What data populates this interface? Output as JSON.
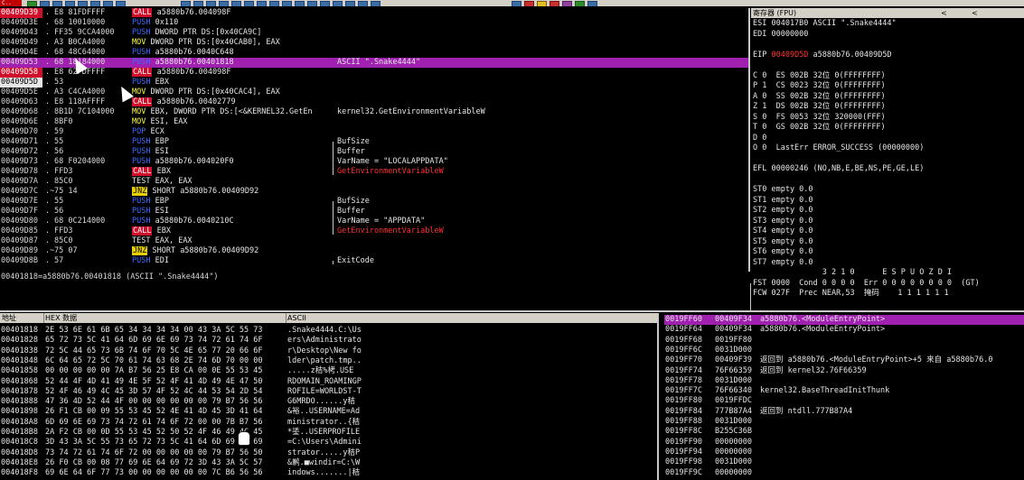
{
  "toolbar": {
    "title": "C.."
  },
  "disasm": {
    "rows": [
      {
        "addr": "00409D39",
        "mark": ".",
        "hex": "E8 81FDFFFF",
        "mn_kw": "CALL",
        "mn_kw_type": "call",
        "mn_rest": "a5880b76.004098F",
        "comment": "",
        "addr_style": "red",
        "selected": false
      },
      {
        "addr": "00409D3E",
        "mark": ".",
        "hex": "68 10010000",
        "mn_kw": "PUSH",
        "mn_kw_type": "push",
        "mn_rest": "0x110",
        "comment": "",
        "addr_style": "",
        "selected": false
      },
      {
        "addr": "00409D43",
        "mark": ".",
        "hex": "FF35 9CCA4000",
        "mn_kw": "PUSH",
        "mn_kw_type": "push",
        "mn_rest": "DWORD PTR DS:[0x40CA9C]",
        "comment": "",
        "addr_style": "",
        "selected": false
      },
      {
        "addr": "00409D49",
        "mark": ".",
        "hex": "A3 B0CA4000",
        "mn_kw": "MOV",
        "mn_kw_type": "mov",
        "mn_rest": "DWORD PTR DS:[0x40CAB0], EAX",
        "comment": "",
        "addr_style": "",
        "selected": false
      },
      {
        "addr": "00409D4E",
        "mark": ".",
        "hex": "68 48C64000",
        "mn_kw": "PUSH",
        "mn_kw_type": "push",
        "mn_rest": "a5880b76.0040C648",
        "comment": "",
        "addr_style": "",
        "selected": false
      },
      {
        "addr": "00409D53",
        "mark": ".",
        "hex": "68 18184000",
        "mn_kw": "PUSH",
        "mn_kw_type": "push",
        "mn_rest": "a5880b76.00401818",
        "comment": "ASCII \".Snake4444\"",
        "addr_style": "",
        "selected": true
      },
      {
        "addr": "00409D58",
        "mark": ".",
        "hex": "E8 62FDFFFF",
        "mn_kw": "CALL",
        "mn_kw_type": "call",
        "mn_rest": "a5880b76.004098F",
        "comment": "",
        "addr_style": "red",
        "selected": false
      },
      {
        "addr": "00409D5D",
        "mark": ".",
        "hex": "53",
        "mn_kw": "PUSH",
        "mn_kw_type": "push",
        "mn_rest": "EBX",
        "comment": "",
        "addr_style": "inv",
        "selected": false
      },
      {
        "addr": "00409D5E",
        "mark": ".",
        "hex": "A3 C4CA4000",
        "mn_kw": "MOV",
        "mn_kw_type": "mov",
        "mn_rest": "DWORD PTR DS:[0x40CAC4], EAX",
        "comment": "",
        "addr_style": "",
        "selected": false
      },
      {
        "addr": "00409D63",
        "mark": ".",
        "hex": "E8 118AFFFF",
        "mn_kw": "CALL",
        "mn_kw_type": "call",
        "mn_rest": "a5880b76.00402779",
        "comment": "",
        "addr_style": "",
        "selected": false
      },
      {
        "addr": "00409D68",
        "mark": ".",
        "hex": "8B1D 7C104000",
        "mn_kw": "MOV",
        "mn_kw_type": "mov",
        "mn_rest": "EBX, DWORD PTR DS:[<&KERNEL32.GetEn",
        "comment": "kernel32.GetEnvironmentVariableW",
        "addr_style": "",
        "selected": false
      },
      {
        "addr": "00409D6E",
        "mark": ".",
        "hex": "8BF0",
        "mn_kw": "MOV",
        "mn_kw_type": "mov2",
        "mn_rest": "ESI, EAX",
        "comment": "",
        "addr_style": "",
        "selected": false
      },
      {
        "addr": "00409D70",
        "mark": ".",
        "hex": "59",
        "mn_kw": "POP",
        "mn_kw_type": "pop",
        "mn_rest": "ECX",
        "comment": "",
        "addr_style": "",
        "selected": false
      },
      {
        "addr": "00409D71",
        "mark": ".",
        "hex": "55",
        "mn_kw": "PUSH",
        "mn_kw_type": "push",
        "mn_rest": "EBP",
        "comment": "BufSize",
        "addr_style": "",
        "selected": false
      },
      {
        "addr": "00409D72",
        "mark": ".",
        "hex": "56",
        "mn_kw": "PUSH",
        "mn_kw_type": "push",
        "mn_rest": "ESI",
        "comment": "Buffer",
        "addr_style": "",
        "selected": false
      },
      {
        "addr": "00409D73",
        "mark": ".",
        "hex": "68 F0204000",
        "mn_kw": "PUSH",
        "mn_kw_type": "push",
        "mn_rest": "a5880b76.004020F0",
        "comment": "VarName = \"LOCALAPPDATA\"",
        "addr_style": "",
        "selected": false
      },
      {
        "addr": "00409D78",
        "mark": ".",
        "hex": "FFD3",
        "mn_kw": "CALL",
        "mn_kw_type": "call",
        "mn_rest": "EBX",
        "comment": "GetEnvironmentVariableW",
        "comment_red": true,
        "addr_style": "",
        "selected": false
      },
      {
        "addr": "00409D7A",
        "mark": ".",
        "hex": "85C0",
        "mn_kw": "TEST",
        "mn_kw_type": "test",
        "mn_rest": "EAX, EAX",
        "comment": "",
        "addr_style": "",
        "selected": false
      },
      {
        "addr": "00409D7C",
        "mark": ".~",
        "hex": "75 14",
        "mn_kw": "JNZ",
        "mn_kw_type": "jmp",
        "mn_rest": "SHORT a5880b76.00409D92",
        "comment": "",
        "addr_style": "",
        "selected": false
      },
      {
        "addr": "00409D7E",
        "mark": ".",
        "hex": "55",
        "mn_kw": "PUSH",
        "mn_kw_type": "push",
        "mn_rest": "EBP",
        "comment": "BufSize",
        "addr_style": "",
        "selected": false
      },
      {
        "addr": "00409D7F",
        "mark": ".",
        "hex": "56",
        "mn_kw": "PUSH",
        "mn_kw_type": "push",
        "mn_rest": "ESI",
        "comment": "Buffer",
        "addr_style": "",
        "selected": false
      },
      {
        "addr": "00409D80",
        "mark": ".",
        "hex": "68 0C214000",
        "mn_kw": "PUSH",
        "mn_kw_type": "push",
        "mn_rest": "a5880b76.0040210C",
        "comment": "VarName = \"APPDATA\"",
        "addr_style": "",
        "selected": false
      },
      {
        "addr": "00409D85",
        "mark": ".",
        "hex": "FFD3",
        "mn_kw": "CALL",
        "mn_kw_type": "call",
        "mn_rest": "EBX",
        "comment": "GetEnvironmentVariableW",
        "comment_red": true,
        "addr_style": "",
        "selected": false
      },
      {
        "addr": "00409D87",
        "mark": ".",
        "hex": "85C0",
        "mn_kw": "TEST",
        "mn_kw_type": "test",
        "mn_rest": "EAX, EAX",
        "comment": "",
        "addr_style": "",
        "selected": false
      },
      {
        "addr": "00409D89",
        "mark": ".~",
        "hex": "75 07",
        "mn_kw": "JNZ",
        "mn_kw_type": "jmp",
        "mn_rest": "SHORT a5880b76.00409D92",
        "comment": "",
        "addr_style": "",
        "selected": false
      },
      {
        "addr": "00409D8B",
        "mark": ".",
        "hex": "57",
        "mn_kw": "PUSH",
        "mn_kw_type": "push",
        "mn_rest": "EDI",
        "comment": "ExitCode",
        "addr_style": "",
        "selected": false
      }
    ],
    "status": "00401818=a5880b76.00401818 (ASCII \".Snake4444\")"
  },
  "registers": {
    "title": "寄存器 (FPU)",
    "nav_left": "<",
    "nav_right": "<",
    "lines": [
      {
        "text": "ESI 004017B0 ASCII \".Snake4444\""
      },
      {
        "text": "EDI 00000000"
      },
      {
        "text": ""
      },
      {
        "text": "EIP ",
        "red": "00409D5D",
        "after": " a5880b76.00409D5D"
      },
      {
        "text": ""
      },
      {
        "text": "C 0  ES 002B 32位 0(FFFFFFFF)"
      },
      {
        "text": "P 1  CS 0023 32位 0(FFFFFFFF)"
      },
      {
        "text": "A 0  SS 002B 32位 0(FFFFFFFF)"
      },
      {
        "text": "Z 1  DS 002B 32位 0(FFFFFFFF)"
      },
      {
        "text": "S 0  FS 0053 32位 320000(FFF)"
      },
      {
        "text": "T 0  GS 002B 32位 0(FFFFFFFF)"
      },
      {
        "text": "D 0"
      },
      {
        "text": "O 0  LastErr ERROR_SUCCESS (00000000)"
      },
      {
        "text": ""
      },
      {
        "text": "EFL 00000246 (NO,NB,E,BE,NS,PE,GE,LE)"
      },
      {
        "text": ""
      },
      {
        "text": "ST0 empty 0.0"
      },
      {
        "text": "ST1 empty 0.0"
      },
      {
        "text": "ST2 empty 0.0"
      },
      {
        "text": "ST3 empty 0.0"
      },
      {
        "text": "ST4 empty 0.0"
      },
      {
        "text": "ST5 empty 0.0"
      },
      {
        "text": "ST6 empty 0.0"
      },
      {
        "text": "ST7 empty 0.0"
      },
      {
        "text": "               3 2 1 0      E S P U O Z D I"
      },
      {
        "text": "FST 0000  Cond 0 0 0 0  Err 0 0 0 0 0 0 0 0  (GT)"
      },
      {
        "text": "FCW 027F  Prec NEAR,53  掩码    1 1 1 1 1 1"
      }
    ]
  },
  "dump": {
    "col_addr": "地址",
    "col_hex": "HEX 数据",
    "col_ascii": "ASCII",
    "rows": [
      {
        "addr": "00401818",
        "hex": "2E 53 6E 61 6B 65 34 34 34 34 00 43 3A 5C 55 73",
        "ascii": ".Snake4444.C:\\Us"
      },
      {
        "addr": "00401828",
        "hex": "65 72 73 5C 41 64 6D 69 6E 69 73 74 72 61 74 6F",
        "ascii": "ers\\Administrato"
      },
      {
        "addr": "00401838",
        "hex": "72 5C 44 65 73 6B 74 6F 70 5C 4E 65 77 20 66 6F",
        "ascii": "r\\Desktop\\New fo"
      },
      {
        "addr": "00401848",
        "hex": "6C 64 65 72 5C 70 61 74 63 68 2E 74 6D 70 00 00",
        "ascii": "lder\\patch.tmp.."
      },
      {
        "addr": "00401858",
        "hex": "00 00 00 00 00 7A B7 56 25 E8 CA 00 0E 55 53 45",
        "ascii": ".....z秸%栲.USE"
      },
      {
        "addr": "00401868",
        "hex": "52 44 4F 4D 41 49 4E 5F 52 4F 41 4D 49 4E 47 50",
        "ascii": "RDOMAIN_ROAMINGP"
      },
      {
        "addr": "00401878",
        "hex": "52 4F 46 49 4C 45 3D 57 4F 52 4C 44 53 54 2D 54",
        "ascii": "ROFILE=WORLDST-T"
      },
      {
        "addr": "00401888",
        "hex": "47 36 4D 52 44 4F 00 00 00 00 00 00 79 B7 56 56",
        "ascii": "G6MRDO......y秸"
      },
      {
        "addr": "00401898",
        "hex": "26 F1 CB 00 09 55 53 45 52 4E 41 4D 45 3D 41 64",
        "ascii": "&裕..USERNAME=Ad"
      },
      {
        "addr": "004018A8",
        "hex": "6D 69 6E 69 73 74 72 61 74 6F 72 00 00 7B B7 56",
        "ascii": "ministrator..{秸"
      },
      {
        "addr": "004018B8",
        "hex": "2A F2 CB 00 0D 55 53 45 52 50 52 4F 46 49 4C 45",
        "ascii": "*鋈..USERPROFILE"
      },
      {
        "addr": "004018C8",
        "hex": "3D 43 3A 5C 55 73 65 72 73 5C 41 64 6D 69 6E 69",
        "ascii": "=C:\\Users\\Admini"
      },
      {
        "addr": "004018D8",
        "hex": "73 74 72 61 74 6F 72 00 00 00 00 00 79 B7 56 50",
        "ascii": "strator.....y秸P"
      },
      {
        "addr": "004018E8",
        "hex": "26 F0 CB 00 08 77 69 6E 64 69 72 3D 43 3A 5C 57",
        "ascii": "&鹣.■windir=C:\\W"
      },
      {
        "addr": "004018F8",
        "hex": "69 6E 64 6F 77 73 00 00 00 00 00 00 7C B6 56 56",
        "ascii": "indows.......|秸"
      }
    ]
  },
  "stack": {
    "rows": [
      {
        "addr": "0019FF60",
        "val": "00409F34",
        "desc": "a5880b76.<ModuleEntryPoint>",
        "selected": true
      },
      {
        "addr": "0019FF64",
        "val": "00409F34",
        "desc": "a5880b76.<ModuleEntryPoint>",
        "selected": false
      },
      {
        "addr": "0019FF68",
        "val": "0019FF80",
        "desc": "",
        "selected": false
      },
      {
        "addr": "0019FF6C",
        "val": "0031D000",
        "desc": "",
        "selected": false
      },
      {
        "addr": "0019FF70",
        "val": "00409F39",
        "desc": "返回到 a5880b76.<ModuleEntryPoint>+5 来自 a5880b76.0",
        "selected": false
      },
      {
        "addr": "0019FF74",
        "val": "76F66359",
        "desc": "返回到 kernel32.76F66359",
        "selected": false
      },
      {
        "addr": "0019FF78",
        "val": "0031D000",
        "desc": "",
        "selected": false
      },
      {
        "addr": "0019FF7C",
        "val": "76F66340",
        "desc": "kernel32.BaseThreadInitThunk",
        "selected": false
      },
      {
        "addr": "0019FF80",
        "val": "0019FFDC",
        "desc": "",
        "selected": false
      },
      {
        "addr": "0019FF84",
        "val": "777B87A4",
        "desc": "返回到 ntdll.777B87A4",
        "selected": false
      },
      {
        "addr": "0019FF88",
        "val": "0031D000",
        "desc": "",
        "selected": false
      },
      {
        "addr": "0019FF8C",
        "val": "B255C36B",
        "desc": "",
        "selected": false
      },
      {
        "addr": "0019FF90",
        "val": "00000000",
        "desc": "",
        "selected": false
      },
      {
        "addr": "0019FF94",
        "val": "00000000",
        "desc": "",
        "selected": false
      },
      {
        "addr": "0019FF98",
        "val": "0031D000",
        "desc": "",
        "selected": false
      },
      {
        "addr": "0019FF9C",
        "val": "00000000",
        "desc": "",
        "selected": false
      }
    ]
  }
}
